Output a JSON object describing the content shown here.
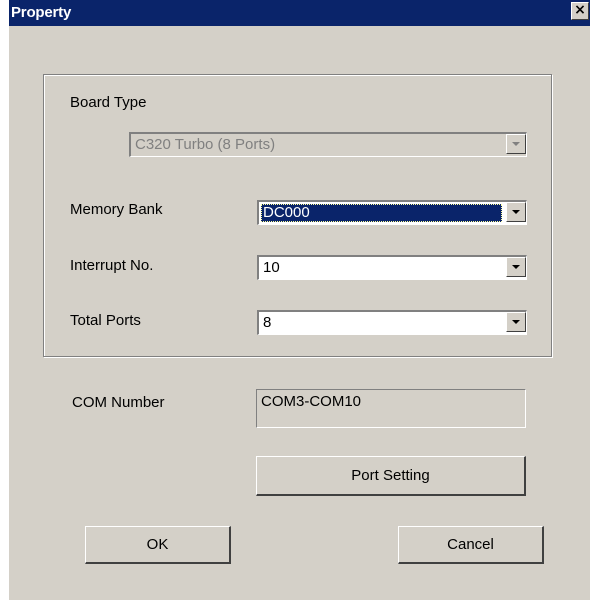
{
  "window": {
    "title": "Property",
    "close_glyph": "×"
  },
  "board": {
    "board_type_label": "Board Type",
    "board_type_value": "C320 Turbo (8 Ports)",
    "memory_bank_label": "Memory Bank",
    "memory_bank_value": "DC000",
    "interrupt_label": "Interrupt No.",
    "interrupt_value": "10",
    "total_ports_label": "Total Ports",
    "total_ports_value": "8"
  },
  "com": {
    "label": "COM Number",
    "value": "COM3-COM10"
  },
  "buttons": {
    "port_setting": "Port Setting",
    "ok": "OK",
    "cancel": "Cancel"
  },
  "colors": {
    "title_bar": "#0a246a",
    "dialog_face": "#d4d0c8",
    "selection": "#0a246a"
  }
}
